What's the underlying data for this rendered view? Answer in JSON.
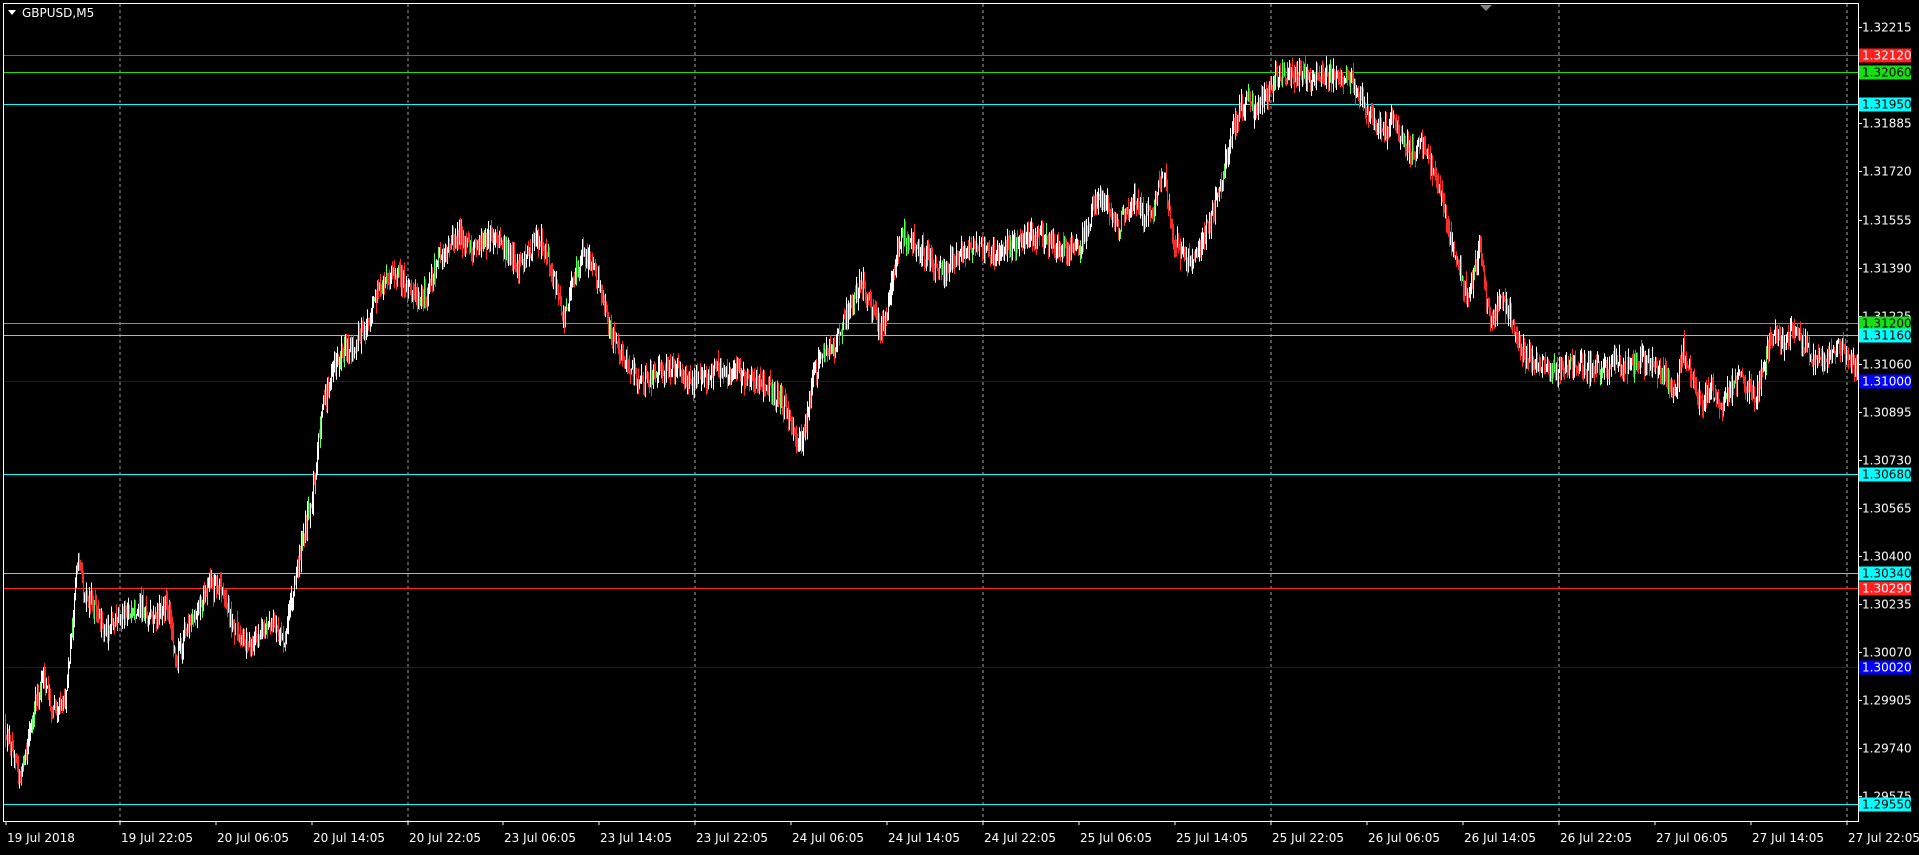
{
  "window": {
    "symbol_label": "GBPUSD,M5"
  },
  "chart_data": {
    "type": "candlestick",
    "symbol": "GBPUSD",
    "timeframe": "M5",
    "ylim": [
      1.2949,
      1.32295
    ],
    "grid": "vertical dotted",
    "colors": {
      "background": "#000000",
      "frame": "#ffffff",
      "text": "#ffffff",
      "up": "#ffffff",
      "down": "#ff2a2a",
      "up_alt": "#5dff5d",
      "red": "#ff2020",
      "green": "#14e014",
      "cyan": "#00ffff",
      "blue": "#0000ff"
    },
    "y_ticks": [
      "1.32215",
      "1.31885",
      "1.31720",
      "1.31555",
      "1.31390",
      "1.31225",
      "1.31060",
      "1.30895",
      "1.30730",
      "1.30565",
      "1.30400",
      "1.30235",
      "1.30070",
      "1.29905",
      "1.29740",
      "1.29575"
    ],
    "x_ticks": [
      "19 Jul 2018",
      "19 Jul 22:05",
      "20 Jul 06:05",
      "20 Jul 14:05",
      "20 Jul 22:05",
      "23 Jul 06:05",
      "23 Jul 14:05",
      "23 Jul 22:05",
      "24 Jul 06:05",
      "24 Jul 14:05",
      "24 Jul 22:05",
      "25 Jul 06:05",
      "25 Jul 14:05",
      "25 Jul 22:05",
      "26 Jul 06:05",
      "26 Jul 14:05",
      "26 Jul 22:05",
      "27 Jul 06:05",
      "27 Jul 14:05",
      "27 Jul 22:05"
    ],
    "vertical_grid_at_ticks": [
      "19 Jul 22:05",
      "20 Jul 22:05",
      "23 Jul 22:05",
      "24 Jul 22:05",
      "25 Jul 22:05",
      "26 Jul 22:05",
      "27 Jul 22:05"
    ],
    "horizontal_lines": [
      {
        "price": 1.3212,
        "label": "1.32120",
        "color": "#ff2020"
      },
      {
        "price": 1.3206,
        "label": "1.32060",
        "color": "#14e014"
      },
      {
        "price": 1.3195,
        "label": "1.31950",
        "color": "#00ffff"
      },
      {
        "price": 1.312,
        "label": "1.31200",
        "color": "#14e014"
      },
      {
        "price": 1.3116,
        "label": "1.31160",
        "color": "#00ffff"
      },
      {
        "price": 1.31,
        "label": "1.31000",
        "color": "#0000ff"
      },
      {
        "price": 1.3068,
        "label": "1.30680",
        "color": "#00ffff"
      },
      {
        "price": 1.3034,
        "label": "1.30340",
        "color": "#00ffff"
      },
      {
        "price": 1.3029,
        "label": "1.30290",
        "color": "#ff2020"
      },
      {
        "price": 1.3002,
        "label": "1.30020",
        "color": "#0000ff"
      },
      {
        "price": 1.2955,
        "label": "1.29550",
        "color": "#00ffff"
      }
    ],
    "price_path": [
      [
        0,
        1.2982
      ],
      [
        0.5,
        1.2963
      ],
      [
        1.0,
        1.299
      ],
      [
        1.3,
        1.2998
      ],
      [
        1.6,
        1.2985
      ],
      [
        2.0,
        1.299
      ],
      [
        2.4,
        1.304
      ],
      [
        2.6,
        1.3027
      ],
      [
        3.0,
        1.3022
      ],
      [
        3.3,
        1.3013
      ],
      [
        3.6,
        1.3018
      ],
      [
        4.0,
        1.302
      ],
      [
        4.4,
        1.3023
      ],
      [
        4.9,
        1.3017
      ],
      [
        5.3,
        1.3025
      ],
      [
        5.6,
        1.3002
      ],
      [
        5.9,
        1.3015
      ],
      [
        6.3,
        1.3022
      ],
      [
        6.7,
        1.303
      ],
      [
        7.1,
        1.3028
      ],
      [
        7.5,
        1.3015
      ],
      [
        8.0,
        1.3008
      ],
      [
        8.3,
        1.3013
      ],
      [
        8.7,
        1.3017
      ],
      [
        9.1,
        1.3012
      ],
      [
        9.4,
        1.3028
      ],
      [
        9.7,
        1.3045
      ],
      [
        10.0,
        1.306
      ],
      [
        10.3,
        1.3088
      ],
      [
        10.6,
        1.3102
      ],
      [
        11.0,
        1.311
      ],
      [
        11.4,
        1.3113
      ],
      [
        11.8,
        1.312
      ],
      [
        12.1,
        1.313
      ],
      [
        12.4,
        1.3135
      ],
      [
        12.8,
        1.3137
      ],
      [
        13.2,
        1.313
      ],
      [
        13.6,
        1.3128
      ],
      [
        14.0,
        1.3138
      ],
      [
        14.4,
        1.3147
      ],
      [
        14.8,
        1.315
      ],
      [
        15.2,
        1.3145
      ],
      [
        15.5,
        1.3148
      ],
      [
        15.9,
        1.315
      ],
      [
        16.3,
        1.3145
      ],
      [
        16.7,
        1.314
      ],
      [
        17.0,
        1.3143
      ],
      [
        17.3,
        1.315
      ],
      [
        17.6,
        1.3145
      ],
      [
        17.9,
        1.3135
      ],
      [
        18.2,
        1.312
      ],
      [
        18.5,
        1.3135
      ],
      [
        18.8,
        1.3143
      ],
      [
        19.1,
        1.314
      ],
      [
        19.4,
        1.3132
      ],
      [
        19.7,
        1.3118
      ],
      [
        20.0,
        1.311
      ],
      [
        20.4,
        1.3104
      ],
      [
        20.8,
        1.31
      ],
      [
        21.2,
        1.3102
      ],
      [
        21.6,
        1.3105
      ],
      [
        22.0,
        1.3103
      ],
      [
        22.4,
        1.31
      ],
      [
        22.8,
        1.3102
      ],
      [
        23.2,
        1.3104
      ],
      [
        23.6,
        1.3103
      ],
      [
        24.0,
        1.3102
      ],
      [
        24.4,
        1.3101
      ],
      [
        24.8,
        1.3098
      ],
      [
        25.2,
        1.3094
      ],
      [
        25.5,
        1.3088
      ],
      [
        25.8,
        1.3078
      ],
      [
        26.0,
        1.3082
      ],
      [
        26.3,
        1.31
      ],
      [
        26.6,
        1.311
      ],
      [
        27.0,
        1.3112
      ],
      [
        27.3,
        1.312
      ],
      [
        27.6,
        1.3128
      ],
      [
        27.9,
        1.3134
      ],
      [
        28.2,
        1.3125
      ],
      [
        28.5,
        1.3118
      ],
      [
        28.7,
        1.3122
      ],
      [
        28.9,
        1.3138
      ],
      [
        29.2,
        1.315
      ],
      [
        29.5,
        1.3148
      ],
      [
        29.8,
        1.3145
      ],
      [
        30.2,
        1.314
      ],
      [
        30.6,
        1.3138
      ],
      [
        31.0,
        1.3142
      ],
      [
        31.4,
        1.3146
      ],
      [
        31.8,
        1.3145
      ],
      [
        32.2,
        1.3143
      ],
      [
        32.6,
        1.3146
      ],
      [
        33.0,
        1.3148
      ],
      [
        33.4,
        1.315
      ],
      [
        33.8,
        1.3149
      ],
      [
        34.2,
        1.3146
      ],
      [
        34.6,
        1.3143
      ],
      [
        35.0,
        1.3147
      ],
      [
        35.3,
        1.3155
      ],
      [
        35.6,
        1.3165
      ],
      [
        35.9,
        1.316
      ],
      [
        36.2,
        1.3152
      ],
      [
        36.5,
        1.3158
      ],
      [
        36.8,
        1.3162
      ],
      [
        37.1,
        1.3156
      ],
      [
        37.4,
        1.316
      ],
      [
        37.7,
        1.3172
      ],
      [
        38.0,
        1.315
      ],
      [
        38.3,
        1.3143
      ],
      [
        38.6,
        1.3141
      ],
      [
        38.9,
        1.3148
      ],
      [
        39.2,
        1.3154
      ],
      [
        39.5,
        1.3165
      ],
      [
        39.8,
        1.318
      ],
      [
        40.1,
        1.3192
      ],
      [
        40.4,
        1.3197
      ],
      [
        40.7,
        1.3192
      ],
      [
        41.0,
        1.3198
      ],
      [
        41.3,
        1.3203
      ],
      [
        41.6,
        1.3206
      ],
      [
        41.9,
        1.3205
      ],
      [
        42.2,
        1.3206
      ],
      [
        42.5,
        1.3204
      ],
      [
        42.8,
        1.3206
      ],
      [
        43.1,
        1.3205
      ],
      [
        43.4,
        1.3203
      ],
      [
        43.7,
        1.3205
      ],
      [
        44.0,
        1.32
      ],
      [
        44.3,
        1.3193
      ],
      [
        44.6,
        1.3188
      ],
      [
        44.9,
        1.3186
      ],
      [
        45.2,
        1.3189
      ],
      [
        45.5,
        1.3182
      ],
      [
        45.8,
        1.3178
      ],
      [
        46.1,
        1.3183
      ],
      [
        46.4,
        1.3175
      ],
      [
        46.7,
        1.3165
      ],
      [
        47.0,
        1.315
      ],
      [
        47.3,
        1.314
      ],
      [
        47.6,
        1.3128
      ],
      [
        47.8,
        1.3138
      ],
      [
        48.0,
        1.3147
      ],
      [
        48.2,
        1.313
      ],
      [
        48.4,
        1.312
      ],
      [
        48.7,
        1.3128
      ],
      [
        49.0,
        1.3122
      ],
      [
        49.3,
        1.311
      ],
      [
        49.6,
        1.3108
      ],
      [
        50.0,
        1.3106
      ],
      [
        50.4,
        1.3103
      ],
      [
        50.8,
        1.3105
      ],
      [
        51.2,
        1.3106
      ],
      [
        51.6,
        1.3104
      ],
      [
        52.0,
        1.3104
      ],
      [
        52.4,
        1.3107
      ],
      [
        52.8,
        1.3105
      ],
      [
        53.2,
        1.3108
      ],
      [
        53.6,
        1.3105
      ],
      [
        54.0,
        1.3102
      ],
      [
        54.3,
        1.3095
      ],
      [
        54.6,
        1.3112
      ],
      [
        54.9,
        1.31
      ],
      [
        55.2,
        1.3092
      ],
      [
        55.5,
        1.3098
      ],
      [
        55.8,
        1.309
      ],
      [
        56.1,
        1.3097
      ],
      [
        56.4,
        1.3103
      ],
      [
        56.7,
        1.3098
      ],
      [
        57.0,
        1.3095
      ],
      [
        57.3,
        1.311
      ],
      [
        57.6,
        1.3117
      ],
      [
        57.9,
        1.3112
      ],
      [
        58.2,
        1.3118
      ],
      [
        58.5,
        1.3113
      ],
      [
        58.8,
        1.3108
      ],
      [
        59.1,
        1.3106
      ],
      [
        59.4,
        1.311
      ],
      [
        59.7,
        1.3112
      ],
      [
        60.0,
        1.3107
      ],
      [
        60.3,
        1.3106
      ]
    ],
    "price_points": "generated in script from price_path with per-bar noise"
  }
}
